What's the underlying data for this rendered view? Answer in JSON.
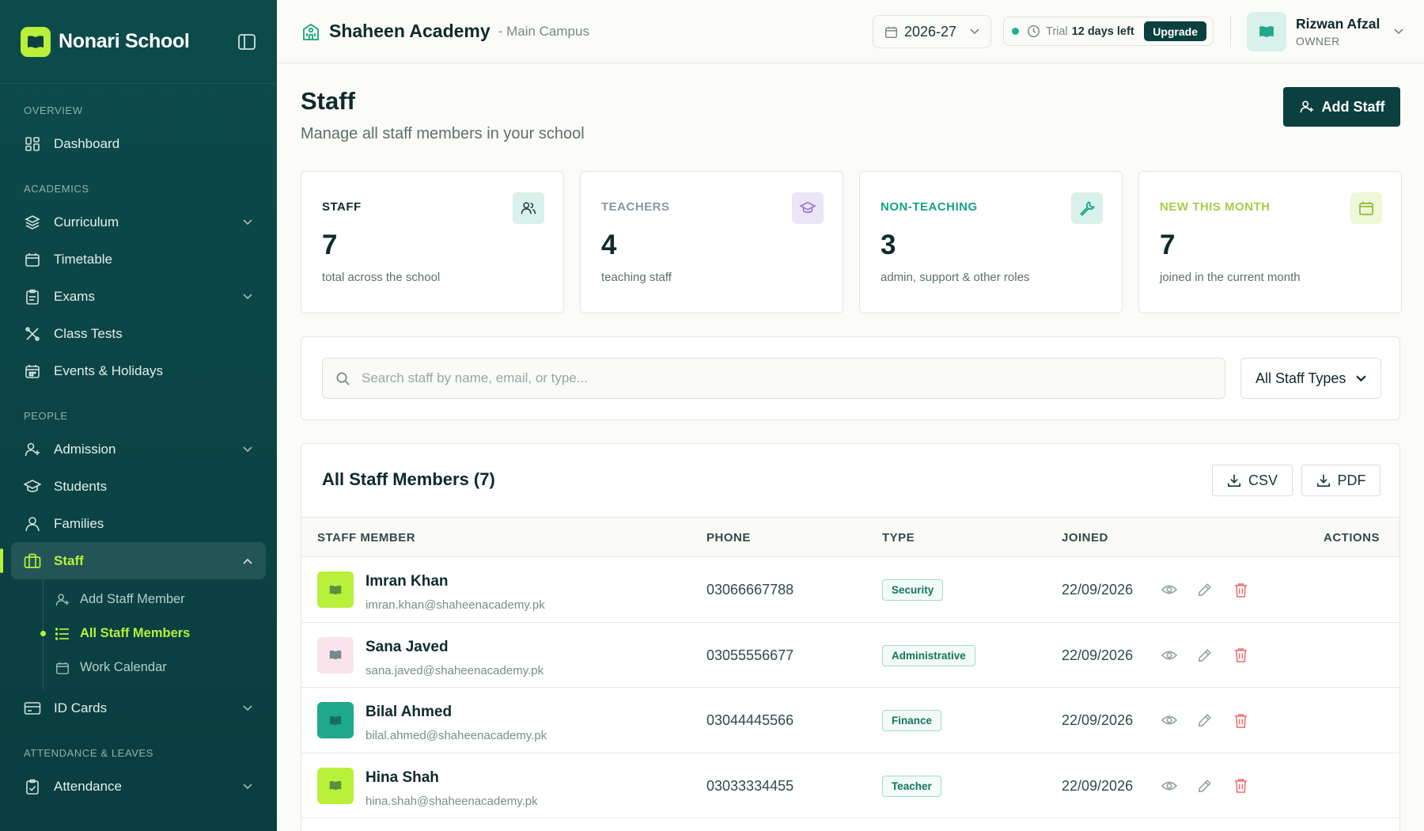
{
  "brand": {
    "name": "Nonari School"
  },
  "sidebar": {
    "sections": {
      "overview": "OVERVIEW",
      "academics": "ACADEMICS",
      "people": "PEOPLE",
      "attendance": "ATTENDANCE & LEAVES"
    },
    "items": {
      "dashboard": "Dashboard",
      "curriculum": "Curriculum",
      "timetable": "Timetable",
      "exams": "Exams",
      "class_tests": "Class Tests",
      "events": "Events & Holidays",
      "admission": "Admission",
      "students": "Students",
      "families": "Families",
      "staff": "Staff",
      "id_cards": "ID Cards",
      "attendance": "Attendance"
    },
    "staff_sub": {
      "add": "Add Staff Member",
      "all": "All Staff Members",
      "calendar": "Work Calendar"
    }
  },
  "topbar": {
    "school_name": "Shaheen Academy",
    "campus": "- Main Campus",
    "year": "2026-27",
    "trial_label": "Trial",
    "trial_days": "12 days left",
    "upgrade": "Upgrade",
    "user_name": "Rizwan Afzal",
    "user_role": "OWNER"
  },
  "page": {
    "title": "Staff",
    "subtitle": "Manage all staff members in your school",
    "add_button": "Add Staff"
  },
  "stats": [
    {
      "label": "STAFF",
      "value": "7",
      "desc": "total across the school",
      "color": "#0f2a2a",
      "icon_bg": "#d8f1ea"
    },
    {
      "label": "TEACHERS",
      "value": "4",
      "desc": "teaching staff",
      "color": "#8b96a4",
      "icon_bg": "#ebe5f7"
    },
    {
      "label": "NON-TEACHING",
      "value": "3",
      "desc": "admin, support & other roles",
      "color": "#14a383",
      "icon_bg": "#d8f1ea"
    },
    {
      "label": "NEW THIS MONTH",
      "value": "7",
      "desc": "joined in the current month",
      "color": "#a6cf4a",
      "icon_bg": "#eef7d8"
    }
  ],
  "search": {
    "placeholder": "Search staff by name, email, or type...",
    "type_filter": "All Staff Types"
  },
  "table": {
    "title": "All Staff Members (7)",
    "export_csv": "CSV",
    "export_pdf": "PDF",
    "columns": {
      "member": "STAFF MEMBER",
      "phone": "PHONE",
      "type": "TYPE",
      "joined": "JOINED",
      "actions": "ACTIONS"
    },
    "rows": [
      {
        "name": "Imran Khan",
        "email": "imran.khan@shaheenacademy.pk",
        "phone": "03066667788",
        "type": "Security",
        "joined": "22/09/2026",
        "avatar_color": "#b8f03a"
      },
      {
        "name": "Sana Javed",
        "email": "sana.javed@shaheenacademy.pk",
        "phone": "03055556677",
        "type": "Administrative",
        "joined": "22/09/2026",
        "avatar_color": "#fbe3ec"
      },
      {
        "name": "Bilal Ahmed",
        "email": "bilal.ahmed@shaheenacademy.pk",
        "phone": "03044445566",
        "type": "Finance",
        "joined": "22/09/2026",
        "avatar_color": "#1fa98a"
      },
      {
        "name": "Hina Shah",
        "email": "hina.shah@shaheenacademy.pk",
        "phone": "03033334455",
        "type": "Teacher",
        "joined": "22/09/2026",
        "avatar_color": "#b8f03a"
      }
    ]
  }
}
